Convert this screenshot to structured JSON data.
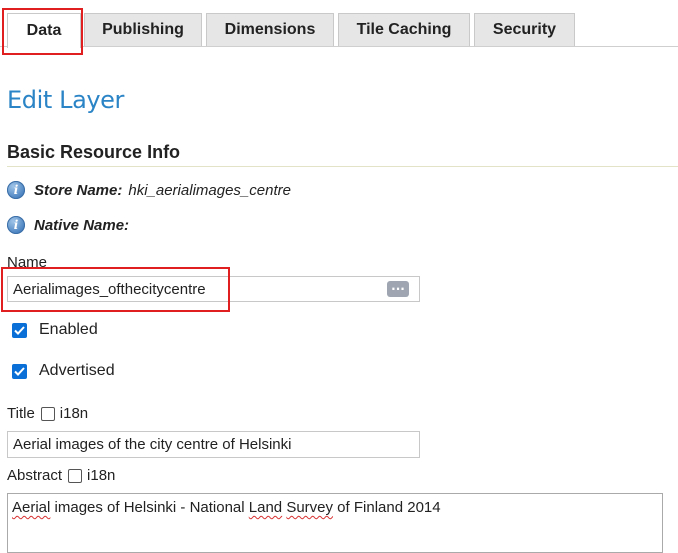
{
  "tabs": [
    {
      "label": "Data",
      "active": true
    },
    {
      "label": "Publishing"
    },
    {
      "label": "Dimensions"
    },
    {
      "label": "Tile Caching"
    },
    {
      "label": "Security"
    }
  ],
  "page": {
    "title": "Edit Layer"
  },
  "basic_info": {
    "section_title": "Basic Resource Info",
    "store_name_label": "Store Name:",
    "store_name_value": "hki_aerialimages_centre",
    "native_name_label": "Native Name:",
    "native_name_value": ""
  },
  "form": {
    "name_label": "Name",
    "name_value": "Aerialimages_ofthecitycentre",
    "enabled_label": "Enabled",
    "enabled": true,
    "advertised_label": "Advertised",
    "advertised": true,
    "title_label": "Title",
    "title_i18n_label": "i18n",
    "title_value": "Aerial images of the city centre of Helsinki",
    "abstract_label": "Abstract",
    "abstract_i18n_label": "i18n",
    "abstract_parts": [
      "Aerial",
      " images of Helsinki - National ",
      "Land",
      " ",
      "Survey",
      " of Finland 2014"
    ]
  },
  "colors": {
    "accent": "#2a84c6",
    "highlight": "#e02020",
    "checkbox": "#0a6fd6"
  }
}
